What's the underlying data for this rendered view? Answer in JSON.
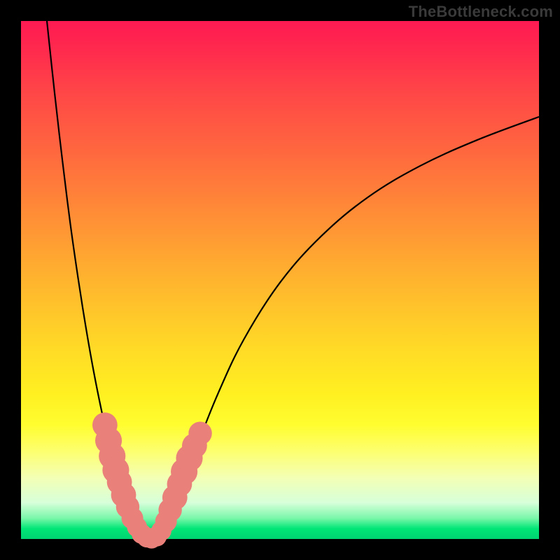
{
  "watermark": "TheBottleneck.com",
  "colors": {
    "frame": "#000000",
    "curve": "#000000",
    "bead": "#e98079",
    "gradient_stops": [
      "#ff1a52",
      "#ff2b4d",
      "#ff4747",
      "#ff6a3e",
      "#ff8f36",
      "#ffb42e",
      "#ffd727",
      "#fff021",
      "#fffd30",
      "#fdff6e",
      "#f4ffb3",
      "#d7ffda",
      "#79f7a9",
      "#00e676",
      "#00d372"
    ]
  },
  "chart_data": {
    "type": "line",
    "title": "",
    "xlabel": "",
    "ylabel": "",
    "xlim": [
      0,
      100
    ],
    "ylim": [
      0,
      100
    ],
    "grid": false,
    "series": [
      {
        "name": "left-curve",
        "x": [
          5.0,
          6.5,
          8.0,
          9.5,
          11.0,
          12.5,
          14.0,
          15.5,
          17.0,
          18.5,
          20.0,
          21.5,
          23.0,
          24.0
        ],
        "y": [
          100.0,
          86.0,
          73.0,
          61.0,
          50.5,
          41.0,
          32.5,
          25.0,
          18.3,
          12.5,
          7.5,
          4.0,
          1.5,
          0.3
        ]
      },
      {
        "name": "right-curve",
        "x": [
          26.0,
          27.5,
          29.0,
          31.0,
          34.0,
          38.0,
          43.0,
          50.0,
          58.0,
          67.0,
          77.0,
          88.0,
          100.0
        ],
        "y": [
          0.3,
          2.0,
          5.0,
          10.0,
          18.0,
          28.0,
          38.5,
          49.5,
          58.5,
          66.0,
          72.0,
          77.0,
          81.5
        ]
      }
    ],
    "markers": [
      {
        "series": "left-beads",
        "points": [
          {
            "x": 16.2,
            "y": 22.0,
            "r": 1.3
          },
          {
            "x": 16.9,
            "y": 19.0,
            "r": 1.4
          },
          {
            "x": 17.6,
            "y": 16.0,
            "r": 1.4
          },
          {
            "x": 18.3,
            "y": 13.3,
            "r": 1.4
          },
          {
            "x": 19.0,
            "y": 11.0,
            "r": 1.3
          },
          {
            "x": 19.8,
            "y": 8.5,
            "r": 1.3
          },
          {
            "x": 20.6,
            "y": 6.2,
            "r": 1.2
          },
          {
            "x": 21.5,
            "y": 4.0,
            "r": 1.1
          },
          {
            "x": 22.4,
            "y": 2.3,
            "r": 1.0
          },
          {
            "x": 23.3,
            "y": 1.0,
            "r": 1.0
          },
          {
            "x": 24.3,
            "y": 0.3,
            "r": 1.0
          },
          {
            "x": 25.2,
            "y": 0.1,
            "r": 1.0
          }
        ]
      },
      {
        "series": "right-beads",
        "points": [
          {
            "x": 26.2,
            "y": 0.5,
            "r": 1.0
          },
          {
            "x": 27.1,
            "y": 1.6,
            "r": 1.0
          },
          {
            "x": 28.0,
            "y": 3.4,
            "r": 1.1
          },
          {
            "x": 28.8,
            "y": 5.6,
            "r": 1.2
          },
          {
            "x": 29.7,
            "y": 8.0,
            "r": 1.3
          },
          {
            "x": 30.6,
            "y": 10.6,
            "r": 1.3
          },
          {
            "x": 31.5,
            "y": 13.0,
            "r": 1.4
          },
          {
            "x": 32.5,
            "y": 15.6,
            "r": 1.4
          },
          {
            "x": 33.5,
            "y": 18.0,
            "r": 1.3
          },
          {
            "x": 34.6,
            "y": 20.4,
            "r": 1.2
          }
        ]
      }
    ]
  }
}
